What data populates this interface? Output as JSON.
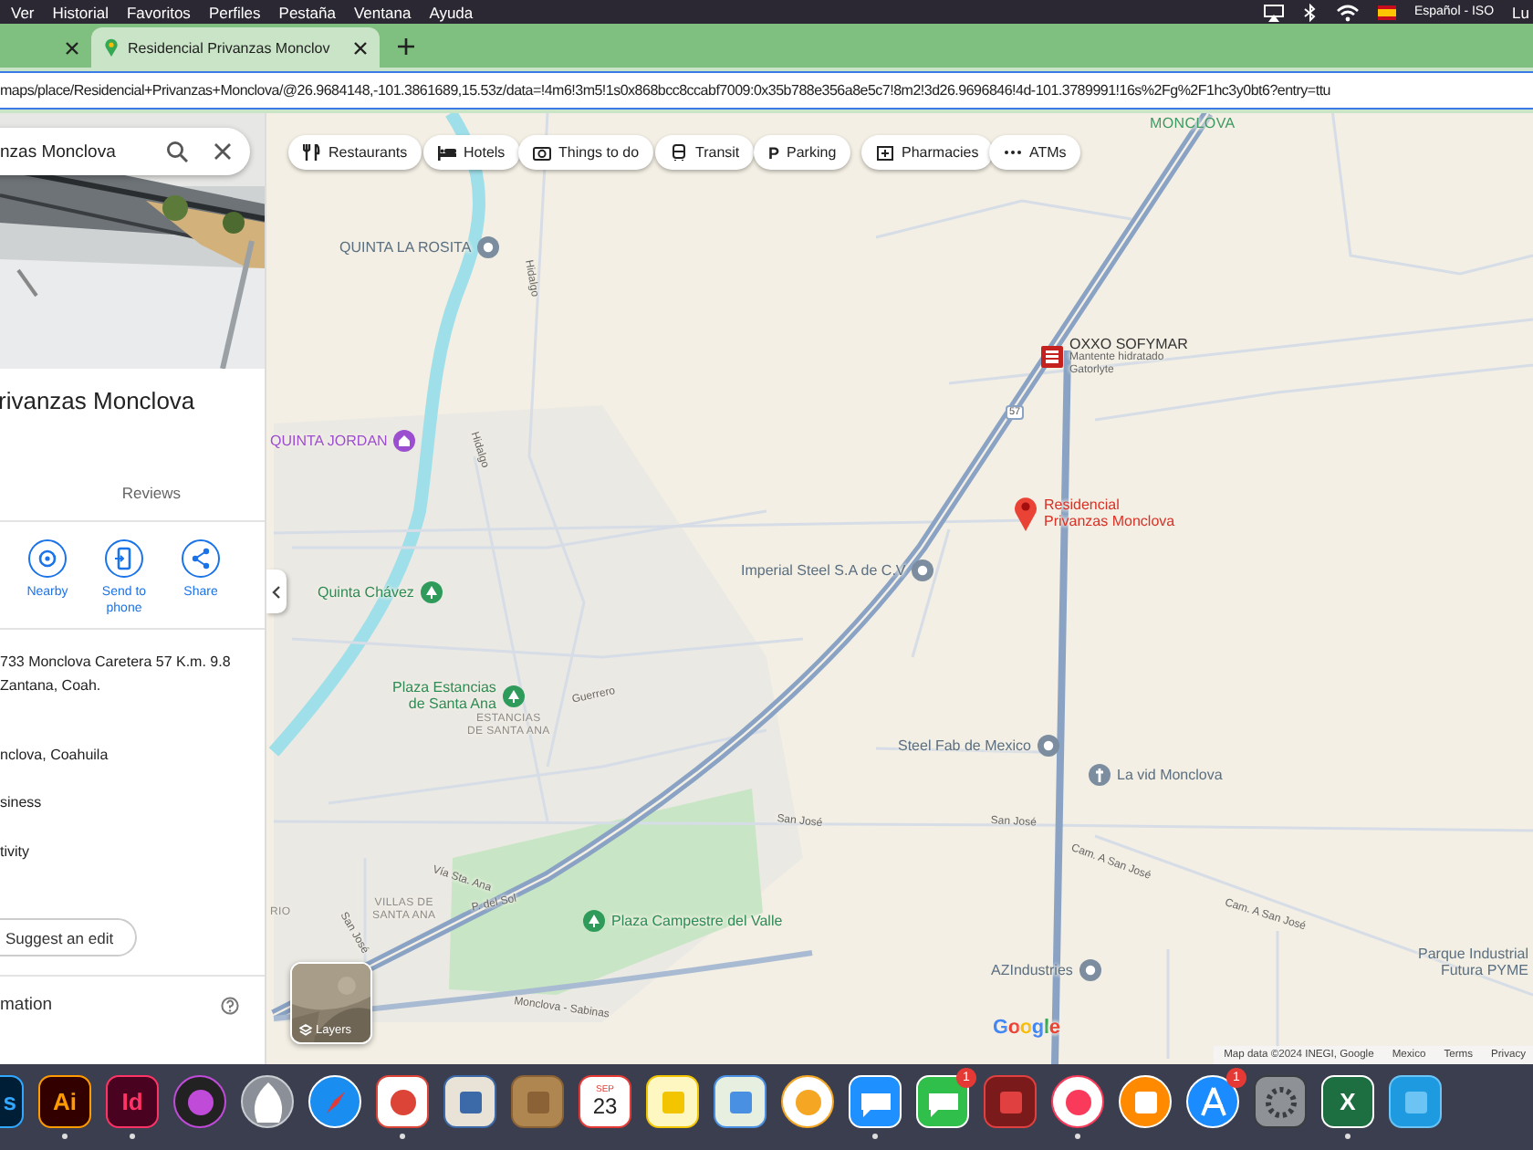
{
  "menu_bar": {
    "items": [
      "Ver",
      "Historial",
      "Favoritos",
      "Perfiles",
      "Pestaña",
      "Ventana",
      "Ayuda"
    ],
    "input_source": "Español - ISO",
    "clock": "Lu"
  },
  "tabs": [
    {
      "selected": false
    },
    {
      "title": "Residencial Privanzas Monclov",
      "selected": true
    }
  ],
  "address_bar": {
    "url": "maps/place/Residencial+Privanzas+Monclova/@26.9684148,-101.3861689,15.53z/data=!4m6!3m5!1s0x868bcc8ccabf7009:0x35b788e356a8e5c7!8m2!3d26.9696846!4d-101.3789991!16s%2Fg%2F1hc3y0bt6?entry=ttu"
  },
  "side_panel": {
    "search": {
      "value": "nzas Monclova"
    },
    "title": "rivanzas Monclova",
    "tabs": [
      {
        "label": "Reviews",
        "selected": false
      }
    ],
    "actions": [
      {
        "label": "Nearby",
        "kind": "nearby"
      },
      {
        "label": "Send to phone",
        "kind": "send"
      },
      {
        "label": "Share",
        "kind": "share"
      }
    ],
    "details": [
      {
        "lines": [
          "733 Monclova Caretera 57 K.m. 9.8",
          "Zantana, Coah."
        ]
      },
      {
        "lines": [
          "nclova, Coahuila"
        ]
      },
      {
        "lines": [
          "siness"
        ]
      },
      {
        "lines": [
          "tivity"
        ]
      }
    ],
    "suggest_button": "Suggest an edit",
    "section": "mation"
  },
  "map": {
    "chips": [
      {
        "label": "Restaurants",
        "kind": "restaurant"
      },
      {
        "label": "Hotels",
        "kind": "hotel"
      },
      {
        "label": "Things to do",
        "kind": "camera"
      },
      {
        "label": "Transit",
        "kind": "transit"
      },
      {
        "label": "Parking",
        "kind": "parking",
        "glyph": "P"
      },
      {
        "label": "Pharmacies",
        "kind": "pharmacy"
      },
      {
        "label": "ATMs",
        "kind": "atm"
      }
    ],
    "places": [
      {
        "lines": [
          "QUINTA LA ROSITA"
        ],
        "kind": "poi"
      },
      {
        "lines": [
          "QUINTA JORDAN"
        ],
        "kind": "lodging"
      },
      {
        "lines": [
          "Quinta Chávez"
        ],
        "kind": "park"
      },
      {
        "lines": [
          "Plaza Estancias",
          "de Santa Ana"
        ],
        "kind": "park"
      },
      {
        "lines": [
          "Plaza Campestre del Valle"
        ],
        "kind": "park"
      },
      {
        "lines": [
          "Imperial Steel S.A de C.V"
        ],
        "kind": "poi"
      },
      {
        "lines": [
          "OXXO SOFYMAR"
        ],
        "note": [
          "Mantente hidratado",
          "Gatorlyte"
        ],
        "kind": "store"
      },
      {
        "lines": [
          "Residencial",
          "Privanzas Monclova"
        ],
        "kind": "pin"
      },
      {
        "lines": [
          "Steel Fab de Mexico"
        ],
        "kind": "poi"
      },
      {
        "lines": [
          "La vid Monclova"
        ],
        "kind": "church"
      },
      {
        "lines": [
          "AZIndustries"
        ],
        "kind": "poi"
      },
      {
        "lines": [
          "Parque Industrial",
          "Futura PYME"
        ],
        "kind": "text"
      }
    ],
    "road_labels": [
      "Hidalgo",
      "Hidalgo",
      "Guerrero",
      "Vía Sta. Ana",
      "P. del Sol",
      "San José",
      "Monclova - Sabinas",
      "San José",
      "San José",
      "Cam. A San José",
      "Cam. A San José"
    ],
    "highway_shield": "57",
    "area_labels": [
      {
        "lines": [
          "MONCLOVA"
        ],
        "kind": "city"
      },
      {
        "lines": [
          "ESTANCIAS",
          "DE SANTA ANA"
        ],
        "kind": "district"
      },
      {
        "lines": [
          "RIO"
        ],
        "kind": "district"
      },
      {
        "lines": [
          "VILLAS DE",
          "SANTA ANA"
        ],
        "kind": "district"
      }
    ],
    "layers_button": "Layers",
    "logo": "Google",
    "attribution": [
      "Map data ©2024 INEGI, Google",
      "Mexico",
      "Terms",
      "Privacy"
    ]
  },
  "dock": [
    {
      "kind": "ps",
      "label": "s"
    },
    {
      "kind": "ai",
      "label": "Ai",
      "running": true
    },
    {
      "kind": "id",
      "label": "Id",
      "running": true
    },
    {
      "kind": "siri",
      "running": false
    },
    {
      "kind": "rocket",
      "running": false
    },
    {
      "kind": "compass",
      "running": false
    },
    {
      "kind": "browser",
      "running": true
    },
    {
      "kind": "mail",
      "running": false
    },
    {
      "kind": "contacts",
      "running": false
    },
    {
      "kind": "calendar",
      "month": "SEP",
      "day": "23",
      "running": false
    },
    {
      "kind": "notes",
      "running": false
    },
    {
      "kind": "maps",
      "running": false
    },
    {
      "kind": "photos",
      "running": false
    },
    {
      "kind": "messages",
      "running": true
    },
    {
      "kind": "facetime",
      "badge": "1",
      "running": false
    },
    {
      "kind": "booth",
      "running": false
    },
    {
      "kind": "music",
      "running": true
    },
    {
      "kind": "books",
      "running": false
    },
    {
      "kind": "store",
      "badge": "1",
      "running": false
    },
    {
      "kind": "prefs",
      "running": false
    },
    {
      "kind": "excel",
      "label": "X",
      "running": true
    },
    {
      "kind": "folder",
      "running": false
    }
  ]
}
